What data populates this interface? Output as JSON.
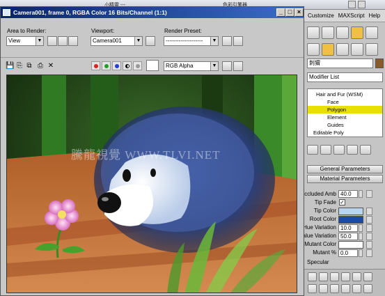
{
  "app": {
    "topbar_fragment": "小精靈 ---",
    "topbar_right": "色彩引擎器",
    "menu": [
      "Customize",
      "MAXScript",
      "Help"
    ]
  },
  "render_window": {
    "title": "Camera001, frame 0, RGBA Color 16 Bits/Channel (1:1)",
    "area_label": "Area to Render:",
    "area_value": "View",
    "viewport_label": "Viewport:",
    "viewport_value": "Camera001",
    "preset_label": "Render Preset:",
    "preset_value": "--------------------",
    "channel_value": "RGB Alpha",
    "watermark": "騰龍視覺 WWW.TLVI.NET"
  },
  "command_panel": {
    "name_field": "刺猬",
    "modifier_list": "Modifier List",
    "stack": [
      {
        "label": "Hair and Fur (WSM)",
        "selected": false
      },
      {
        "label": "Face",
        "selected": false
      },
      {
        "label": "Polygon",
        "selected": true
      },
      {
        "label": "Element",
        "selected": false
      },
      {
        "label": "Guides",
        "selected": false
      },
      {
        "label": "Editable Poly",
        "selected": false
      }
    ],
    "rollouts": [
      "General Parameters",
      "Material Parameters"
    ],
    "params": {
      "occluded_amb_label": "Occluded Amb.",
      "occluded_amb_value": "40.0",
      "tip_fade_label": "Tip Fade",
      "tip_fade_checked": "✓",
      "tip_color_label": "Tip Color",
      "tip_color": "#b8d4ee",
      "root_color_label": "Root Color",
      "root_color": "#1a4aa8",
      "hue_variation_label": "Hue Variation",
      "hue_variation_value": "10.0",
      "value_variation_label": "Value Variation",
      "value_variation_value": "50.0",
      "mutant_color_label": "Mutant Color",
      "mutant_color": "#ffffff",
      "mutant_pct_label": "Mutant %",
      "mutant_pct_value": "0.0",
      "specular_label": "Specular"
    }
  },
  "colors": {
    "title_bar": "#0a246a",
    "selection": "#e8e000",
    "active_tool": "#f0c040"
  }
}
